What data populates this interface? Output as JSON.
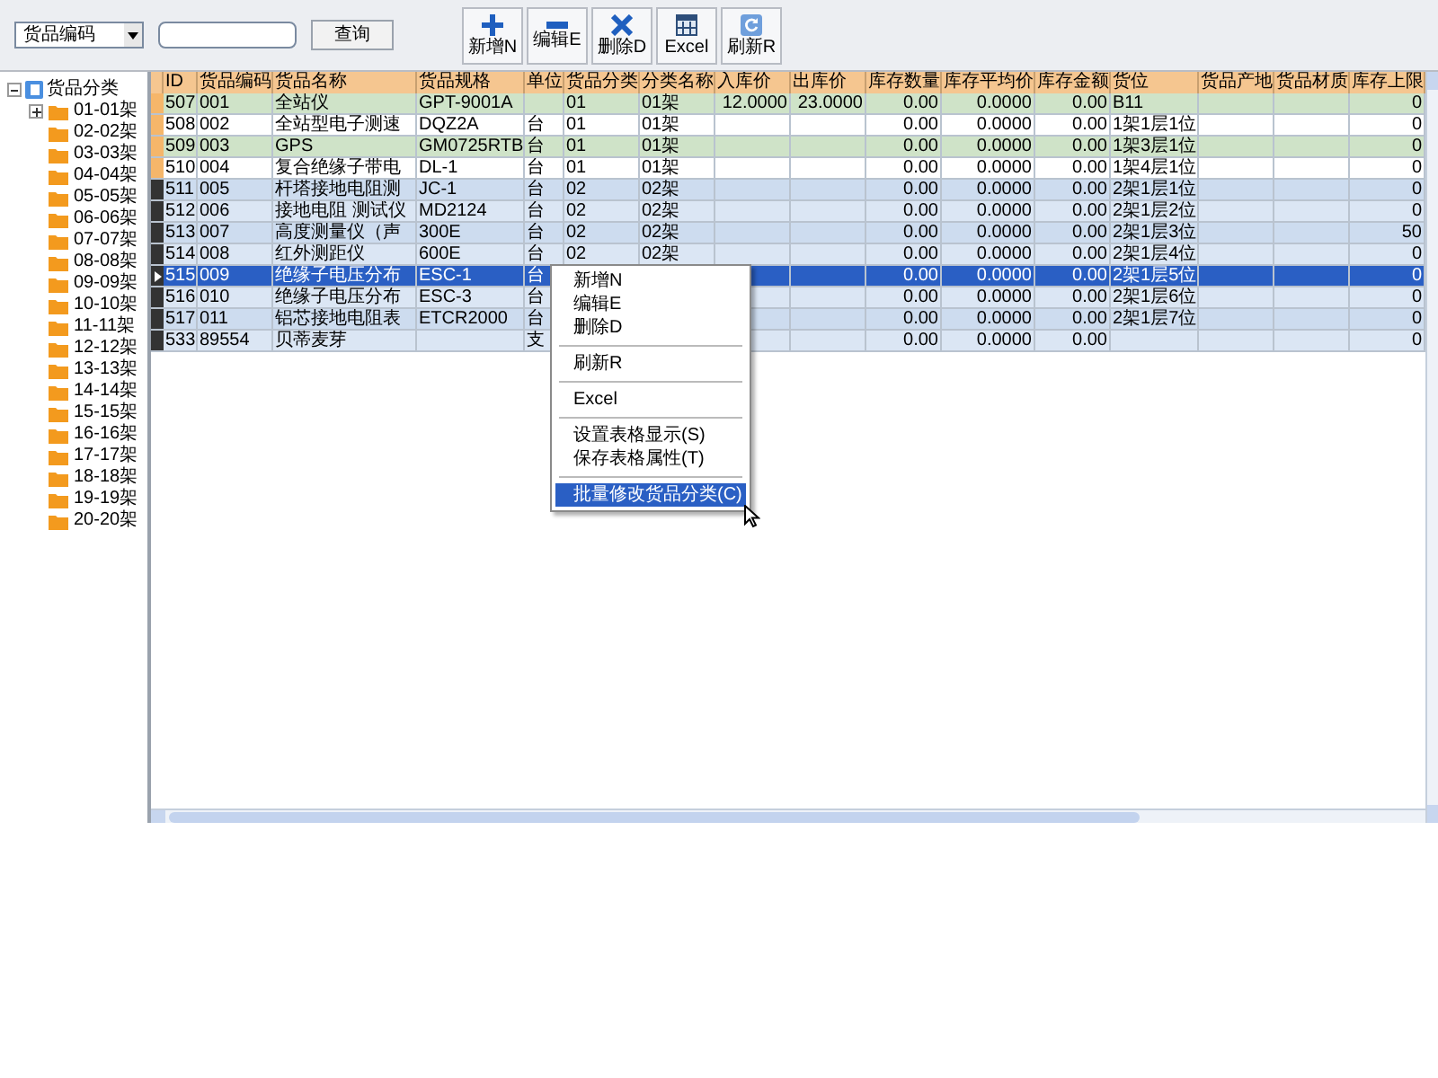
{
  "toolbar": {
    "search_by": "货品编码",
    "query_button": "查询",
    "buttons": [
      {
        "kind": "add",
        "label": "新增N"
      },
      {
        "kind": "edit",
        "label": "编辑E"
      },
      {
        "kind": "delete",
        "label": "删除D"
      },
      {
        "kind": "excel",
        "label": "Excel"
      },
      {
        "kind": "refresh",
        "label": "刷新R"
      }
    ]
  },
  "tree": {
    "label": "货品分类",
    "expanded": true,
    "children": [
      {
        "label": "01-01架",
        "collapsed": true
      },
      {
        "label": "02-02架"
      },
      {
        "label": "03-03架"
      },
      {
        "label": "04-04架"
      },
      {
        "label": "05-05架"
      },
      {
        "label": "06-06架"
      },
      {
        "label": "07-07架"
      },
      {
        "label": "08-08架"
      },
      {
        "label": "09-09架"
      },
      {
        "label": "10-10架"
      },
      {
        "label": "11-11架"
      },
      {
        "label": "12-12架"
      },
      {
        "label": "13-13架"
      },
      {
        "label": "14-14架"
      },
      {
        "label": "15-15架"
      },
      {
        "label": "16-16架"
      },
      {
        "label": "17-17架"
      },
      {
        "label": "18-18架"
      },
      {
        "label": "19-19架"
      },
      {
        "label": "20-20架"
      }
    ]
  },
  "table": {
    "columns": [
      "ID",
      "货品编码",
      "货品名称",
      "货品规格",
      "单位",
      "货品分类",
      "分类名称",
      "入库价",
      "出库价",
      "库存数量",
      "库存平均价",
      "库存金额",
      "货位",
      "货品产地",
      "货品材质",
      "库存上限"
    ],
    "rows": [
      {
        "selected": false,
        "marked": false,
        "color": "#cfe3c8",
        "cells": [
          "507",
          "001",
          "全站仪",
          "GPT-9001A",
          null,
          "01",
          "01架",
          "12.0000",
          "23.0000",
          "0.00",
          "0.0000",
          "0.00",
          "B11",
          null,
          null,
          "0"
        ]
      },
      {
        "selected": false,
        "marked": false,
        "color": "#ffffff",
        "cells": [
          "508",
          "002",
          "全站型电子测速",
          "DQZ2A",
          "台",
          "01",
          "01架",
          null,
          null,
          "0.00",
          "0.0000",
          "0.00",
          "1架1层1位",
          null,
          null,
          "0"
        ]
      },
      {
        "selected": false,
        "marked": false,
        "color": "#cfe3c8",
        "cells": [
          "509",
          "003",
          "GPS",
          "GM0725RTB",
          "台",
          "01",
          "01架",
          null,
          null,
          "0.00",
          "0.0000",
          "0.00",
          "1架3层1位",
          null,
          null,
          "0"
        ]
      },
      {
        "selected": false,
        "marked": false,
        "color": "#ffffff",
        "cells": [
          "510",
          "004",
          "复合绝缘子带电",
          "DL-1",
          "台",
          "01",
          "01架",
          null,
          null,
          "0.00",
          "0.0000",
          "0.00",
          "1架4层1位",
          null,
          null,
          "0"
        ]
      },
      {
        "selected": false,
        "marked": true,
        "color": "#cddcef",
        "cells": [
          "511",
          "005",
          "杆塔接地电阻测",
          "JC-1",
          "台",
          "02",
          "02架",
          null,
          null,
          "0.00",
          "0.0000",
          "0.00",
          "2架1层1位",
          null,
          null,
          "0"
        ]
      },
      {
        "selected": false,
        "marked": true,
        "color": "#dbe6f4",
        "cells": [
          "512",
          "006",
          "接地电阻 测试仪",
          "MD2124",
          "台",
          "02",
          "02架",
          null,
          null,
          "0.00",
          "0.0000",
          "0.00",
          "2架1层2位",
          null,
          null,
          "0"
        ]
      },
      {
        "selected": false,
        "marked": true,
        "color": "#cddcef",
        "cells": [
          "513",
          "007",
          "高度测量仪（声",
          "300E",
          "台",
          "02",
          "02架",
          null,
          null,
          "0.00",
          "0.0000",
          "0.00",
          "2架1层3位",
          null,
          null,
          "50"
        ]
      },
      {
        "selected": false,
        "marked": true,
        "color": "#dbe6f4",
        "cells": [
          "514",
          "008",
          "红外测距仪",
          "600E",
          "台",
          "02",
          "02架",
          null,
          null,
          "0.00",
          "0.0000",
          "0.00",
          "2架1层4位",
          null,
          null,
          "0"
        ]
      },
      {
        "selected": true,
        "marked": true,
        "color": "#2a5fc4",
        "cells": [
          "515",
          "009",
          "绝缘子电压分布",
          "ESC-1",
          "台",
          null,
          null,
          null,
          null,
          "0.00",
          "0.0000",
          "0.00",
          "2架1层5位",
          null,
          null,
          "0"
        ]
      },
      {
        "selected": false,
        "marked": true,
        "color": "#dbe6f4",
        "cells": [
          "516",
          "010",
          "绝缘子电压分布",
          "ESC-3",
          "台",
          null,
          null,
          null,
          null,
          "0.00",
          "0.0000",
          "0.00",
          "2架1层6位",
          null,
          null,
          "0"
        ]
      },
      {
        "selected": false,
        "marked": true,
        "color": "#cddcef",
        "cells": [
          "517",
          "011",
          "铝芯接地电阻表",
          "ETCR2000",
          "台",
          null,
          null,
          null,
          null,
          "0.00",
          "0.0000",
          "0.00",
          "2架1层7位",
          null,
          null,
          "0"
        ]
      },
      {
        "selected": false,
        "marked": true,
        "color": "#dbe6f4",
        "cells": [
          "533",
          "89554",
          "贝蒂麦芽",
          null,
          "支",
          null,
          null,
          null,
          null,
          "0.00",
          "0.0000",
          "0.00",
          null,
          null,
          null,
          "0"
        ]
      }
    ]
  },
  "context_menu": {
    "items": [
      {
        "kind": "item",
        "label": "新增N",
        "selected": false
      },
      {
        "kind": "item",
        "label": "编辑E",
        "selected": false
      },
      {
        "kind": "item",
        "label": "删除D",
        "selected": false
      },
      {
        "kind": "separator"
      },
      {
        "kind": "item",
        "label": "刷新R",
        "selected": false
      },
      {
        "kind": "separator"
      },
      {
        "kind": "item",
        "label": "Excel",
        "selected": false
      },
      {
        "kind": "separator"
      },
      {
        "kind": "item",
        "label": "设置表格显示(S)",
        "selected": false
      },
      {
        "kind": "item",
        "label": "保存表格属性(T)",
        "selected": false
      },
      {
        "kind": "separator"
      },
      {
        "kind": "item",
        "label": "批量修改货品分类(C)",
        "selected": true
      }
    ]
  }
}
